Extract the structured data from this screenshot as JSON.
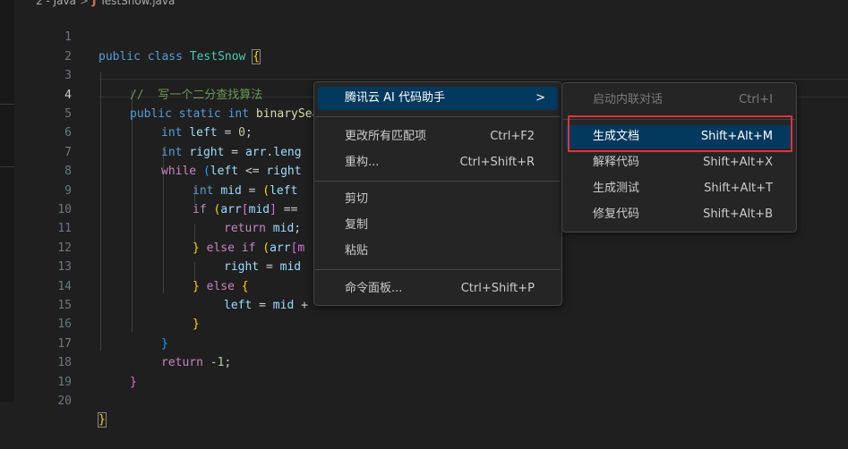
{
  "breadcrumb": {
    "folder": "2 - Java",
    "separator": ">",
    "java_icon": "J",
    "file": "TestSnow.java"
  },
  "editor": {
    "active_line": 4,
    "lines": [
      {
        "n": "1"
      },
      {
        "n": "2"
      },
      {
        "n": "3"
      },
      {
        "n": "4"
      },
      {
        "n": "5"
      },
      {
        "n": "6"
      },
      {
        "n": "7"
      },
      {
        "n": "8"
      },
      {
        "n": "9"
      },
      {
        "n": "10"
      },
      {
        "n": "11"
      },
      {
        "n": "12"
      },
      {
        "n": "13"
      },
      {
        "n": "14"
      },
      {
        "n": "15"
      },
      {
        "n": "16"
      },
      {
        "n": "17"
      },
      {
        "n": "18"
      },
      {
        "n": "19"
      },
      {
        "n": "20"
      }
    ],
    "code": {
      "l1": [
        "public",
        "class",
        "TestSnow",
        "{"
      ],
      "l3": "//  写一个二分查找算法",
      "l4": [
        "public",
        "static",
        "int",
        "binarySearch",
        "(",
        "int",
        "[]",
        "arr",
        ",",
        "int",
        "target",
        ")",
        "{"
      ],
      "l5": [
        "int",
        "left",
        "=",
        "0",
        ";"
      ],
      "l6": [
        "int",
        "right",
        "=",
        "arr",
        ".leng"
      ],
      "l7": [
        "while",
        "(",
        "left",
        "<=",
        "right"
      ],
      "l8": [
        "int",
        "mid",
        "=",
        "(",
        "left"
      ],
      "l9": [
        "if",
        "(",
        "arr",
        "[",
        "mid",
        "]",
        "=="
      ],
      "l10": [
        "return",
        "mid",
        ";"
      ],
      "l11": [
        "}",
        "else",
        "if",
        "(",
        "arr",
        "[m"
      ],
      "l12": [
        "right",
        "=",
        "mid"
      ],
      "l13": [
        "}",
        "else",
        "{"
      ],
      "l14": [
        "left",
        "=",
        "mid",
        "+"
      ],
      "l15": "}",
      "l16": "}",
      "l17": [
        "return",
        "-1",
        ";"
      ],
      "l18": "}",
      "l20": "}"
    }
  },
  "context_menu": {
    "items": [
      {
        "label": "腾讯云 AI 代码助手",
        "shortcut": "",
        "has_submenu": true,
        "chevron": ">"
      },
      {
        "label": "更改所有匹配项",
        "shortcut": "Ctrl+F2"
      },
      {
        "label": "重构...",
        "shortcut": "Ctrl+Shift+R"
      },
      {
        "label": "剪切",
        "shortcut": ""
      },
      {
        "label": "复制",
        "shortcut": ""
      },
      {
        "label": "粘贴",
        "shortcut": ""
      },
      {
        "label": "命令面板...",
        "shortcut": "Ctrl+Shift+P"
      }
    ]
  },
  "submenu": {
    "items": [
      {
        "label": "启动内联对话",
        "shortcut": "Ctrl+I",
        "disabled": true
      },
      {
        "label": "生成文档",
        "shortcut": "Shift+Alt+M",
        "highlighted": true
      },
      {
        "label": "解释代码",
        "shortcut": "Shift+Alt+X"
      },
      {
        "label": "生成测试",
        "shortcut": "Shift+Alt+T"
      },
      {
        "label": "修复代码",
        "shortcut": "Shift+Alt+B"
      }
    ]
  },
  "colors": {
    "background": "#1f1f1f",
    "menu_background": "#252526",
    "selection": "#04395e",
    "highlight_box": "#e0323a",
    "keyword": "#569cd6",
    "function": "#dcdcaa",
    "variable": "#9cdcfe",
    "comment": "#6a9955"
  }
}
